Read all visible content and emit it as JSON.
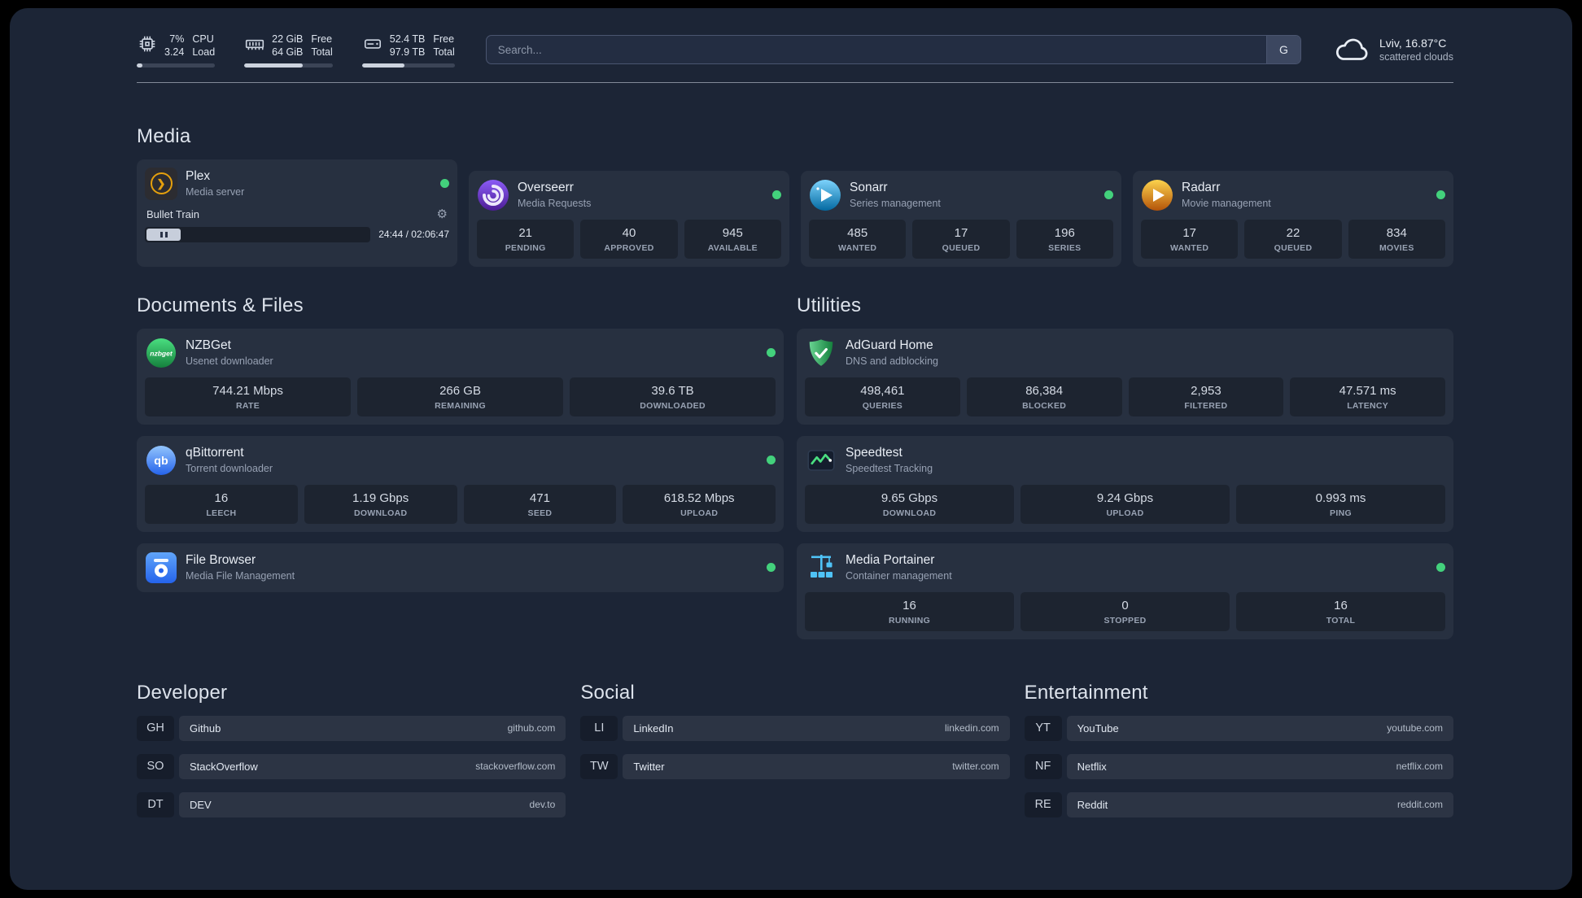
{
  "topbar": {
    "cpu": {
      "percent": "7%",
      "load": "3.24",
      "label_top": "CPU",
      "label_bottom": "Load",
      "progress": 7
    },
    "memory": {
      "free": "22 GiB",
      "total": "64 GiB",
      "label_top": "Free",
      "label_bottom": "Total",
      "progress": 66
    },
    "disk": {
      "free": "52.4 TB",
      "total": "97.9 TB",
      "label_top": "Free",
      "label_bottom": "Total",
      "progress": 46
    },
    "search": {
      "placeholder": "Search...",
      "button_label": "G"
    },
    "weather": {
      "location": "Lviv, 16.87°C",
      "condition": "scattered clouds"
    }
  },
  "media": {
    "title": "Media",
    "plex": {
      "name": "Plex",
      "desc": "Media server",
      "now_playing": "Bullet Train",
      "time": "24:44 / 02:06:47"
    },
    "overseerr": {
      "name": "Overseerr",
      "desc": "Media Requests",
      "stats": [
        {
          "value": "21",
          "label": "PENDING"
        },
        {
          "value": "40",
          "label": "APPROVED"
        },
        {
          "value": "945",
          "label": "AVAILABLE"
        }
      ]
    },
    "sonarr": {
      "name": "Sonarr",
      "desc": "Series management",
      "stats": [
        {
          "value": "485",
          "label": "WANTED"
        },
        {
          "value": "17",
          "label": "QUEUED"
        },
        {
          "value": "196",
          "label": "SERIES"
        }
      ]
    },
    "radarr": {
      "name": "Radarr",
      "desc": "Movie management",
      "stats": [
        {
          "value": "17",
          "label": "WANTED"
        },
        {
          "value": "22",
          "label": "QUEUED"
        },
        {
          "value": "834",
          "label": "MOVIES"
        }
      ]
    }
  },
  "documents": {
    "title": "Documents & Files",
    "nzbget": {
      "name": "NZBGet",
      "desc": "Usenet downloader",
      "stats": [
        {
          "value": "744.21 Mbps",
          "label": "RATE"
        },
        {
          "value": "266 GB",
          "label": "REMAINING"
        },
        {
          "value": "39.6 TB",
          "label": "DOWNLOADED"
        }
      ]
    },
    "qbittorrent": {
      "name": "qBittorrent",
      "desc": "Torrent downloader",
      "stats": [
        {
          "value": "16",
          "label": "LEECH"
        },
        {
          "value": "1.19 Gbps",
          "label": "DOWNLOAD"
        },
        {
          "value": "471",
          "label": "SEED"
        },
        {
          "value": "618.52 Mbps",
          "label": "UPLOAD"
        }
      ]
    },
    "filebrowser": {
      "name": "File Browser",
      "desc": "Media File Management"
    }
  },
  "utilities": {
    "title": "Utilities",
    "adguard": {
      "name": "AdGuard Home",
      "desc": "DNS and adblocking",
      "stats": [
        {
          "value": "498,461",
          "label": "QUERIES"
        },
        {
          "value": "86,384",
          "label": "BLOCKED"
        },
        {
          "value": "2,953",
          "label": "FILTERED"
        },
        {
          "value": "47.571 ms",
          "label": "LATENCY"
        }
      ]
    },
    "speedtest": {
      "name": "Speedtest",
      "desc": "Speedtest Tracking",
      "stats": [
        {
          "value": "9.65 Gbps",
          "label": "DOWNLOAD"
        },
        {
          "value": "9.24 Gbps",
          "label": "UPLOAD"
        },
        {
          "value": "0.993 ms",
          "label": "PING"
        }
      ]
    },
    "portainer": {
      "name": "Media Portainer",
      "desc": "Container management",
      "stats": [
        {
          "value": "16",
          "label": "RUNNING"
        },
        {
          "value": "0",
          "label": "STOPPED"
        },
        {
          "value": "16",
          "label": "TOTAL"
        }
      ]
    }
  },
  "bookmarks": {
    "developer": {
      "title": "Developer",
      "items": [
        {
          "abbr": "GH",
          "name": "Github",
          "url": "github.com"
        },
        {
          "abbr": "SO",
          "name": "StackOverflow",
          "url": "stackoverflow.com"
        },
        {
          "abbr": "DT",
          "name": "DEV",
          "url": "dev.to"
        }
      ]
    },
    "social": {
      "title": "Social",
      "items": [
        {
          "abbr": "LI",
          "name": "LinkedIn",
          "url": "linkedin.com"
        },
        {
          "abbr": "TW",
          "name": "Twitter",
          "url": "twitter.com"
        }
      ]
    },
    "entertainment": {
      "title": "Entertainment",
      "items": [
        {
          "abbr": "YT",
          "name": "YouTube",
          "url": "youtube.com"
        },
        {
          "abbr": "NF",
          "name": "Netflix",
          "url": "netflix.com"
        },
        {
          "abbr": "RE",
          "name": "Reddit",
          "url": "reddit.com"
        }
      ]
    }
  },
  "colors": {
    "status_online": "#43d17c",
    "plex_accent": "#e5a00d",
    "background": "#1c2536"
  }
}
